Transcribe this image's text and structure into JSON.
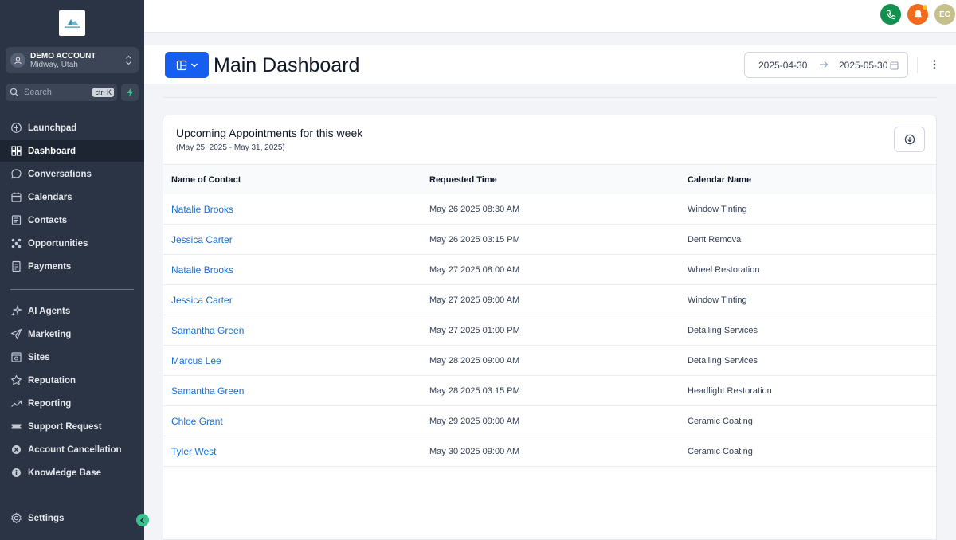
{
  "sidebar": {
    "account": {
      "name": "DEMO ACCOUNT",
      "location": "Midway, Utah"
    },
    "search": {
      "placeholder": "Search",
      "shortcut": "ctrl K"
    },
    "nav_primary": [
      {
        "label": "Launchpad",
        "icon": "launchpad-icon"
      },
      {
        "label": "Dashboard",
        "icon": "dashboard-icon",
        "active": true
      },
      {
        "label": "Conversations",
        "icon": "chat-icon"
      },
      {
        "label": "Calendars",
        "icon": "calendar-icon"
      },
      {
        "label": "Contacts",
        "icon": "contacts-icon"
      },
      {
        "label": "Opportunities",
        "icon": "opportunities-icon"
      },
      {
        "label": "Payments",
        "icon": "payments-icon"
      }
    ],
    "nav_secondary": [
      {
        "label": "AI Agents",
        "icon": "sparkle-icon"
      },
      {
        "label": "Marketing",
        "icon": "send-icon"
      },
      {
        "label": "Sites",
        "icon": "sites-icon"
      },
      {
        "label": "Reputation",
        "icon": "star-icon"
      },
      {
        "label": "Reporting",
        "icon": "trend-icon"
      },
      {
        "label": "Support Request",
        "icon": "ticket-icon"
      },
      {
        "label": "Account Cancellation",
        "icon": "cancel-icon"
      },
      {
        "label": "Knowledge Base",
        "icon": "info-icon"
      }
    ],
    "settings_label": "Settings"
  },
  "topbar": {
    "user_initials": "EC"
  },
  "header": {
    "title": "Main Dashboard",
    "date_start": "2025-04-30",
    "date_end": "2025-05-30"
  },
  "appointments": {
    "title": "Upcoming Appointments for this week",
    "subtitle": "(May 25, 2025 - May 31, 2025)",
    "columns": [
      "Name of Contact",
      "Requested Time",
      "Calendar Name"
    ],
    "rows": [
      {
        "name": "Natalie Brooks",
        "time": "May 26 2025 08:30 AM",
        "calendar": "Window Tinting"
      },
      {
        "name": "Jessica Carter",
        "time": "May 26 2025 03:15 PM",
        "calendar": "Dent Removal"
      },
      {
        "name": "Natalie Brooks",
        "time": "May 27 2025 08:00 AM",
        "calendar": "Wheel Restoration"
      },
      {
        "name": "Jessica Carter",
        "time": "May 27 2025 09:00 AM",
        "calendar": "Window Tinting"
      },
      {
        "name": "Samantha Green",
        "time": "May 27 2025 01:00 PM",
        "calendar": "Detailing Services"
      },
      {
        "name": "Marcus Lee",
        "time": "May 28 2025 09:00 AM",
        "calendar": "Detailing Services"
      },
      {
        "name": "Samantha Green",
        "time": "May 28 2025 03:15 PM",
        "calendar": "Headlight Restoration"
      },
      {
        "name": "Chloe Grant",
        "time": "May 29 2025 09:00 AM",
        "calendar": "Ceramic Coating"
      },
      {
        "name": "Tyler West",
        "time": "May 30 2025 09:00 AM",
        "calendar": "Ceramic Coating"
      }
    ]
  },
  "colors": {
    "sidebar_bg": "#2b3444",
    "primary_blue": "#155eef",
    "link_blue": "#1570d6",
    "phone_green": "#12904d",
    "bell_orange": "#f26b1d"
  }
}
